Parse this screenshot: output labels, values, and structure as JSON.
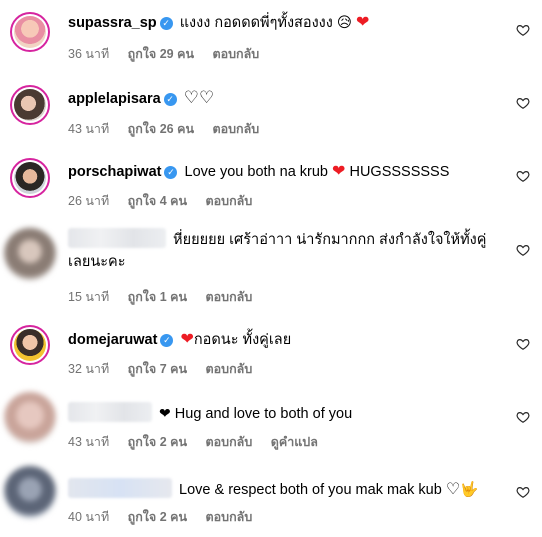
{
  "comments": [
    {
      "username": "supassra_sp",
      "verified": true,
      "text": "แงงง กอดดดพี่ๆทั้งสองงง",
      "emoji_1": "😥",
      "emoji_2": "❤",
      "time": "36 นาที",
      "likes": "ถูกใจ 29 คน",
      "reply": "ตอบกลับ"
    },
    {
      "username": "applelapisara",
      "verified": true,
      "text": "",
      "emoji_1": "♡♡",
      "time": "43 นาที",
      "likes": "ถูกใจ 26 คน",
      "reply": "ตอบกลับ"
    },
    {
      "username": "porschapiwat",
      "verified": true,
      "text": "Love you both na krub",
      "emoji_1": "❤",
      "text_2": "HUGSSSSSSS",
      "time": "26 นาที",
      "likes": "ถูกใจ 4 คน",
      "reply": "ตอบกลับ"
    },
    {
      "username": "",
      "verified": false,
      "text": "หี่ยยยยย เศร้าอ่าาา น่ารักมากกก ส่งกำลังใจให้ทั้งคู่เลยนะคะ",
      "time": "15 นาที",
      "likes": "ถูกใจ 1 คน",
      "reply": "ตอบกลับ"
    },
    {
      "username": "domejaruwat",
      "verified": true,
      "emoji_1": "❤",
      "text": "กอดนะ ทั้งคู่เลย",
      "time": "32 นาที",
      "likes": "ถูกใจ 7 คน",
      "reply": "ตอบกลับ"
    },
    {
      "username": "",
      "verified": false,
      "emoji_1": "❤",
      "text": "Hug and love to both of you",
      "time": "43 นาที",
      "likes": "ถูกใจ 2 คน",
      "reply": "ตอบกลับ",
      "translate": "ดูคำแปล"
    },
    {
      "username": "",
      "verified": false,
      "text": "Love & respect both of you mak mak kub",
      "emoji_1": "♡",
      "emoji_2": "🤟",
      "time": "40 นาที",
      "likes": "ถูกใจ 2 คน",
      "reply": "ตอบกลับ"
    }
  ],
  "icons": {
    "like": "heart-outline-icon",
    "verified": "verified-badge-icon"
  },
  "colors": {
    "verified": "#3897f0",
    "story_ring": "#d6249f",
    "heart": "#ed1c24",
    "meta_text": "#737373"
  }
}
